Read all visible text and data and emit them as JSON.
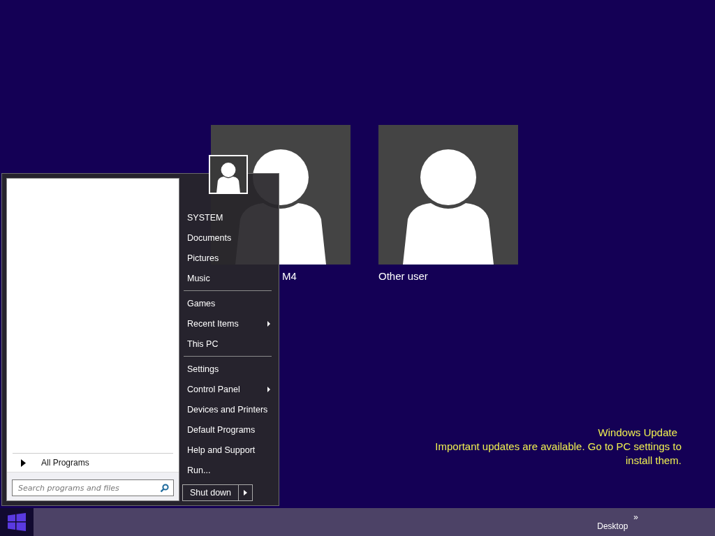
{
  "user_tiles": [
    {
      "name": "M4"
    },
    {
      "name": "Other user"
    }
  ],
  "start_menu": {
    "all_programs": "All Programs",
    "search": {
      "placeholder": "Search programs and files"
    },
    "groups": [
      [
        {
          "label": "SYSTEM",
          "has_submenu": false
        },
        {
          "label": "Documents",
          "has_submenu": false
        },
        {
          "label": "Pictures",
          "has_submenu": false
        },
        {
          "label": "Music",
          "has_submenu": false
        }
      ],
      [
        {
          "label": "Games",
          "has_submenu": false
        },
        {
          "label": "Recent Items",
          "has_submenu": true
        },
        {
          "label": "This PC",
          "has_submenu": false
        }
      ],
      [
        {
          "label": "Settings",
          "has_submenu": false
        },
        {
          "label": "Control Panel",
          "has_submenu": true
        },
        {
          "label": "Devices and Printers",
          "has_submenu": false
        },
        {
          "label": "Default Programs",
          "has_submenu": false
        },
        {
          "label": "Help and Support",
          "has_submenu": false
        },
        {
          "label": "Run...",
          "has_submenu": false
        }
      ]
    ],
    "shutdown": "Shut down"
  },
  "notification": {
    "title": "Windows Update",
    "message": "Important updates are available. Go to PC settings to install them."
  },
  "taskbar": {
    "toolbar": "Desktop",
    "chevron": "»"
  }
}
